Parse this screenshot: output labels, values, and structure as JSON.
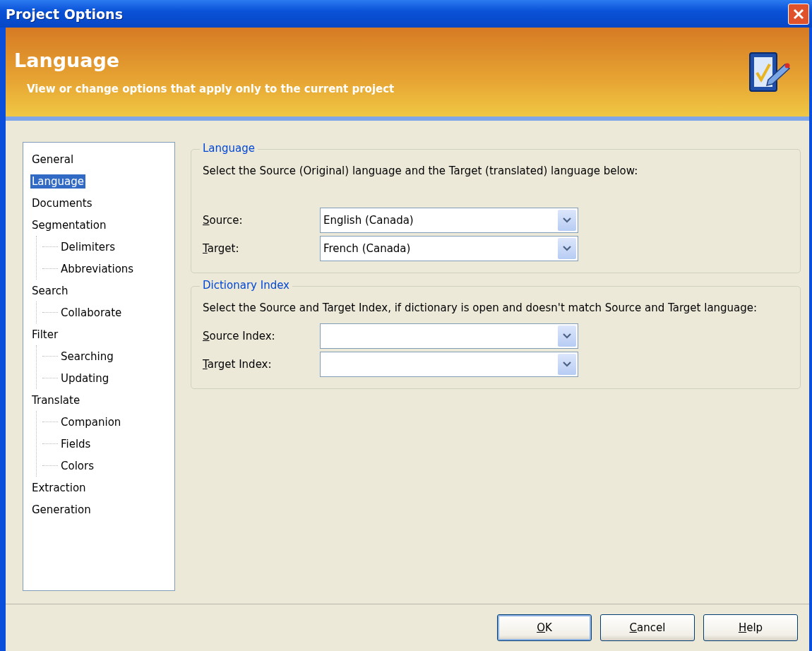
{
  "window": {
    "title": "Project Options"
  },
  "header": {
    "title": "Language",
    "subtitle": "View or change options that apply only to the current project"
  },
  "tree": [
    {
      "label": "General",
      "selected": false
    },
    {
      "label": "Language",
      "selected": true
    },
    {
      "label": "Documents",
      "selected": false
    },
    {
      "label": "Segmentation",
      "selected": false,
      "children": [
        {
          "label": "Delimiters",
          "selected": false
        },
        {
          "label": "Abbreviations",
          "selected": false
        }
      ]
    },
    {
      "label": "Search",
      "selected": false,
      "children": [
        {
          "label": "Collaborate",
          "selected": false
        }
      ]
    },
    {
      "label": "Filter",
      "selected": false,
      "children": [
        {
          "label": "Searching",
          "selected": false
        },
        {
          "label": "Updating",
          "selected": false
        }
      ]
    },
    {
      "label": "Translate",
      "selected": false,
      "children": [
        {
          "label": "Companion",
          "selected": false
        },
        {
          "label": "Fields",
          "selected": false
        },
        {
          "label": "Colors",
          "selected": false
        }
      ]
    },
    {
      "label": "Extraction",
      "selected": false
    },
    {
      "label": "Generation",
      "selected": false
    }
  ],
  "groups": [
    {
      "title": "Language",
      "description": "Select the Source (Original) language and the Target (translated) language below:",
      "fields": [
        {
          "access_key": "S",
          "label_rest": "ource:",
          "value": "English (Canada)"
        },
        {
          "access_key": "T",
          "label_rest": "arget:",
          "value": "French (Canada)"
        }
      ]
    },
    {
      "title": "Dictionary Index",
      "description": "Select the Source and Target Index, if dictionary is open and doesn't match Source and Target language:",
      "fields": [
        {
          "access_key": "S",
          "label_rest": "ource Index:"
        },
        {
          "access_key": "T",
          "label_rest": "arget Index:"
        }
      ]
    }
  ],
  "buttons": [
    {
      "access_key": "O",
      "label_rest": "K",
      "default": true
    },
    {
      "access_key": "C",
      "label_rest": "ancel",
      "default": false
    },
    {
      "access_key": "H",
      "label_rest": "elp",
      "default": false
    }
  ]
}
